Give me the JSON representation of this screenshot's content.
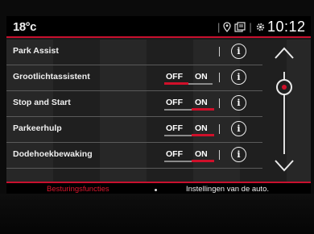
{
  "status": {
    "temperature": "18°c",
    "time": "10:12",
    "icons": [
      "location-pin-icon",
      "phone-sync-icon",
      "settings-gear-icon"
    ]
  },
  "rows": [
    {
      "label": "Park Assist",
      "has_toggle": false
    },
    {
      "label": "Grootlichtassistent",
      "has_toggle": true,
      "off_label": "OFF",
      "on_label": "ON",
      "state": "off"
    },
    {
      "label": "Stop and Start",
      "has_toggle": true,
      "off_label": "OFF",
      "on_label": "ON",
      "state": "on"
    },
    {
      "label": "Parkeerhulp",
      "has_toggle": true,
      "off_label": "OFF",
      "on_label": "ON",
      "state": "on"
    },
    {
      "label": "Dodehoekbewaking",
      "has_toggle": true,
      "off_label": "OFF",
      "on_label": "ON",
      "state": "on"
    }
  ],
  "info_glyph": "i",
  "tabs": {
    "active": "Besturingsfuncties",
    "inactive": "Instellingen van de auto."
  },
  "colors": {
    "accent": "#d0102a",
    "text": "#f0f0f0",
    "background": "#1f1f1f"
  }
}
